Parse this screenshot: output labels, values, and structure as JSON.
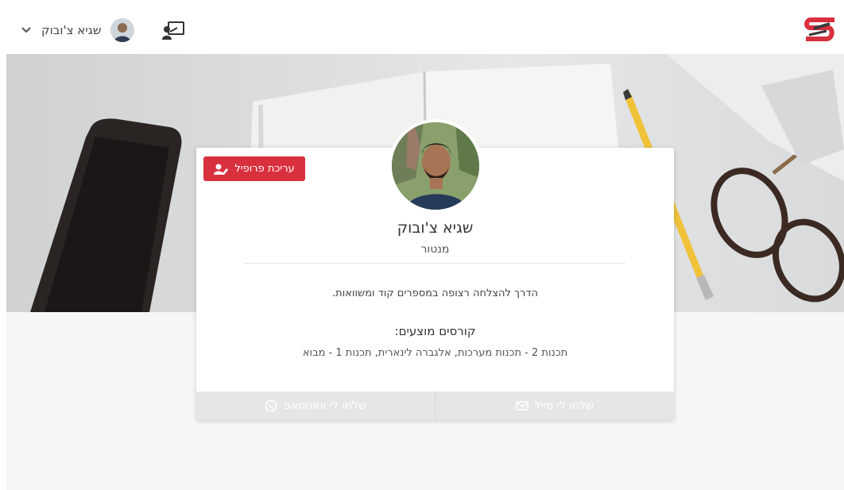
{
  "topbar": {
    "user_name": "שגיא צ'ובוק",
    "icons": {
      "logo": "brand-logo-s",
      "board": "presentation-board-icon",
      "chevron": "chevron-down-icon",
      "avatar": "user-avatar"
    }
  },
  "profile": {
    "edit_label": "עריכת פרופיל",
    "name": "שגיא צ'ובוק",
    "role": "מנטור",
    "bio": "הדרך להצלחה רצופה במספרים קוד ומשוואות.",
    "courses_title": "קורסים מוצעים:",
    "courses_list": "תכנות 2 - תכנות מערכות, אלגברה לינארית, תכנות 1 - מבוא"
  },
  "actions": {
    "whatsapp_label": "שלחו לי וואטסאפ",
    "email_label": "שלחו לי מייל"
  },
  "colors": {
    "accent": "#d9303e",
    "logo_red": "#d9303e",
    "logo_dark": "#3a3a3a"
  }
}
